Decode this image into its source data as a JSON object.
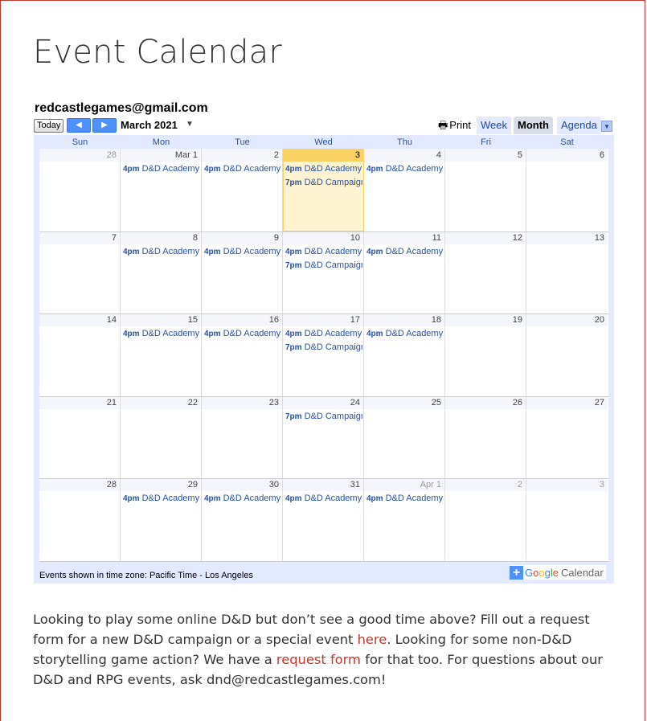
{
  "page": {
    "title": "Event Calendar"
  },
  "calendar": {
    "owner": "redcastlegames@gmail.com",
    "today_label": "Today",
    "prev_icon": "◀",
    "next_icon": "▶",
    "month_label": "March 2021",
    "month_dropdown_icon": "▼",
    "print_label": "Print",
    "print_icon": "🖶",
    "tabs": {
      "week": "Week",
      "month": "Month",
      "agenda": "Agenda"
    },
    "agenda_dropdown_icon": "▼",
    "days_of_week": [
      "Sun",
      "Mon",
      "Tue",
      "Wed",
      "Thu",
      "Fri",
      "Sat"
    ],
    "weeks": [
      {
        "days": [
          {
            "label": "28",
            "off": true,
            "events": []
          },
          {
            "label": "Mar 1",
            "off": false,
            "events": [
              {
                "time": "4pm",
                "title": "D&D Academy"
              }
            ]
          },
          {
            "label": "2",
            "off": false,
            "events": [
              {
                "time": "4pm",
                "title": "D&D Academy"
              }
            ]
          },
          {
            "label": "3",
            "off": false,
            "today": true,
            "events": [
              {
                "time": "4pm",
                "title": "D&D Academy"
              },
              {
                "time": "7pm",
                "title": "D&D Campaign"
              }
            ]
          },
          {
            "label": "4",
            "off": false,
            "events": [
              {
                "time": "4pm",
                "title": "D&D Academy"
              }
            ]
          },
          {
            "label": "5",
            "off": false,
            "events": []
          },
          {
            "label": "6",
            "off": false,
            "events": []
          }
        ]
      },
      {
        "days": [
          {
            "label": "7",
            "off": false,
            "events": []
          },
          {
            "label": "8",
            "off": false,
            "events": [
              {
                "time": "4pm",
                "title": "D&D Academy"
              }
            ]
          },
          {
            "label": "9",
            "off": false,
            "events": [
              {
                "time": "4pm",
                "title": "D&D Academy"
              }
            ]
          },
          {
            "label": "10",
            "off": false,
            "events": [
              {
                "time": "4pm",
                "title": "D&D Academy"
              },
              {
                "time": "7pm",
                "title": "D&D Campaign"
              }
            ]
          },
          {
            "label": "11",
            "off": false,
            "events": [
              {
                "time": "4pm",
                "title": "D&D Academy"
              }
            ]
          },
          {
            "label": "12",
            "off": false,
            "events": []
          },
          {
            "label": "13",
            "off": false,
            "events": []
          }
        ]
      },
      {
        "days": [
          {
            "label": "14",
            "off": false,
            "events": []
          },
          {
            "label": "15",
            "off": false,
            "events": [
              {
                "time": "4pm",
                "title": "D&D Academy"
              }
            ]
          },
          {
            "label": "16",
            "off": false,
            "events": [
              {
                "time": "4pm",
                "title": "D&D Academy"
              }
            ]
          },
          {
            "label": "17",
            "off": false,
            "events": [
              {
                "time": "4pm",
                "title": "D&D Academy"
              },
              {
                "time": "7pm",
                "title": "D&D Campaign"
              }
            ]
          },
          {
            "label": "18",
            "off": false,
            "events": [
              {
                "time": "4pm",
                "title": "D&D Academy"
              }
            ]
          },
          {
            "label": "19",
            "off": false,
            "events": []
          },
          {
            "label": "20",
            "off": false,
            "events": []
          }
        ]
      },
      {
        "days": [
          {
            "label": "21",
            "off": false,
            "events": []
          },
          {
            "label": "22",
            "off": false,
            "events": []
          },
          {
            "label": "23",
            "off": false,
            "events": []
          },
          {
            "label": "24",
            "off": false,
            "events": [
              {
                "time": "7pm",
                "title": "D&D Campaign"
              }
            ]
          },
          {
            "label": "25",
            "off": false,
            "events": []
          },
          {
            "label": "26",
            "off": false,
            "events": []
          },
          {
            "label": "27",
            "off": false,
            "events": []
          }
        ]
      },
      {
        "days": [
          {
            "label": "28",
            "off": false,
            "events": []
          },
          {
            "label": "29",
            "off": false,
            "events": [
              {
                "time": "4pm",
                "title": "D&D Academy"
              }
            ]
          },
          {
            "label": "30",
            "off": false,
            "events": [
              {
                "time": "4pm",
                "title": "D&D Academy"
              }
            ]
          },
          {
            "label": "31",
            "off": false,
            "events": [
              {
                "time": "4pm",
                "title": "D&D Academy"
              }
            ]
          },
          {
            "label": "Apr 1",
            "off": true,
            "events": [
              {
                "time": "4pm",
                "title": "D&D Academy"
              }
            ]
          },
          {
            "label": "2",
            "off": true,
            "events": []
          },
          {
            "label": "3",
            "off": true,
            "events": []
          }
        ]
      }
    ],
    "timezone_note": "Events shown in time zone: Pacific Time - Los Angeles",
    "google_logo": {
      "plus": "+",
      "letters": [
        {
          "ch": "G",
          "color": "#4285f4"
        },
        {
          "ch": "o",
          "color": "#ea4335"
        },
        {
          "ch": "o",
          "color": "#fbbc05"
        },
        {
          "ch": "g",
          "color": "#4285f4"
        },
        {
          "ch": "l",
          "color": "#34a853"
        },
        {
          "ch": "e",
          "color": "#ea4335"
        }
      ],
      "calendar_word": "Calendar"
    }
  },
  "paragraph": {
    "part1": "Looking to play some online D&D but don’t see a good time above? Fill out a request form for a new D&D campaign or a special event ",
    "link1": "here",
    "part2": ". Looking for some non-D&D storytelling game action? We have a ",
    "link2": "request form",
    "part3": " for that too. For questions about our D&D and RPG events, ask dnd@redcastlegames.com!"
  },
  "colors": {
    "frame_border": "#c0392b",
    "link": "#c0392b",
    "calendar_accent": "#2952a3",
    "today_highlight": "#fad163",
    "calendar_background": "#e3e9ff"
  }
}
